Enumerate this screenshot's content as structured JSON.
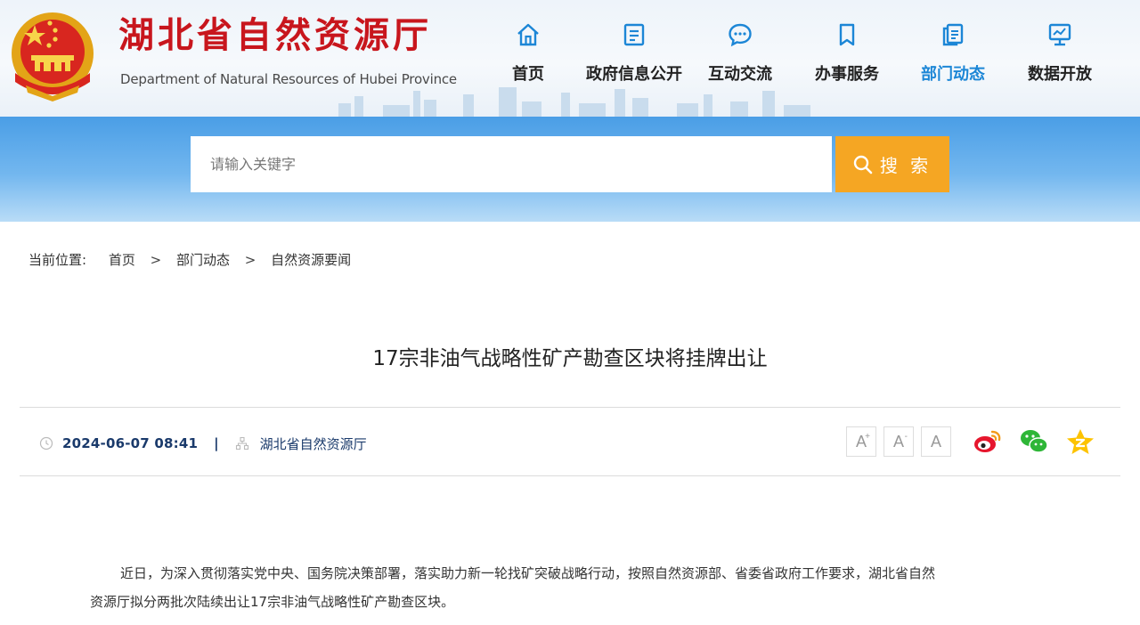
{
  "header": {
    "brand_cn": "湖北省自然资源厅",
    "brand_en": "Department of Natural Resources of Hubei Province",
    "nav": [
      {
        "label": "首页",
        "icon": "home-icon"
      },
      {
        "label": "政府信息公开",
        "icon": "document-list-icon"
      },
      {
        "label": "互动交流",
        "icon": "chat-bubble-icon"
      },
      {
        "label": "办事服务",
        "icon": "bookmark-icon"
      },
      {
        "label": "部门动态",
        "icon": "news-copy-icon",
        "active": true
      },
      {
        "label": "数据开放",
        "icon": "data-screen-icon"
      }
    ],
    "colors": {
      "brand_red": "#c8161d",
      "nav_active": "#1c86d6"
    }
  },
  "search": {
    "placeholder": "请输入关键字",
    "button_label": "搜 索",
    "colors": {
      "band": "#4a9ee6",
      "button": "#f5a623"
    }
  },
  "breadcrumb": {
    "label": "当前位置:",
    "items": [
      "首页",
      "部门动态",
      "自然资源要闻"
    ],
    "separator": ">"
  },
  "article": {
    "title": "17宗非油气战略性矿产勘查区块将挂牌出让",
    "date": "2024-06-07 08:41",
    "separator": "|",
    "source": "湖北省自然资源厅",
    "font_sizes": [
      "A+",
      "A",
      "A"
    ],
    "share": [
      "weibo-icon",
      "wechat-icon",
      "qzone-icon"
    ],
    "paragraph_line1": "近日，为深入贯彻落实党中央、国务院决策部署，落实助力新一轮找矿突破战略行动，按照自然资源部、省委省政府工作要求，湖北省自然",
    "paragraph_line2": "资源厅拟分两批次陆续出让17宗非油气战略性矿产勘查区块。"
  }
}
